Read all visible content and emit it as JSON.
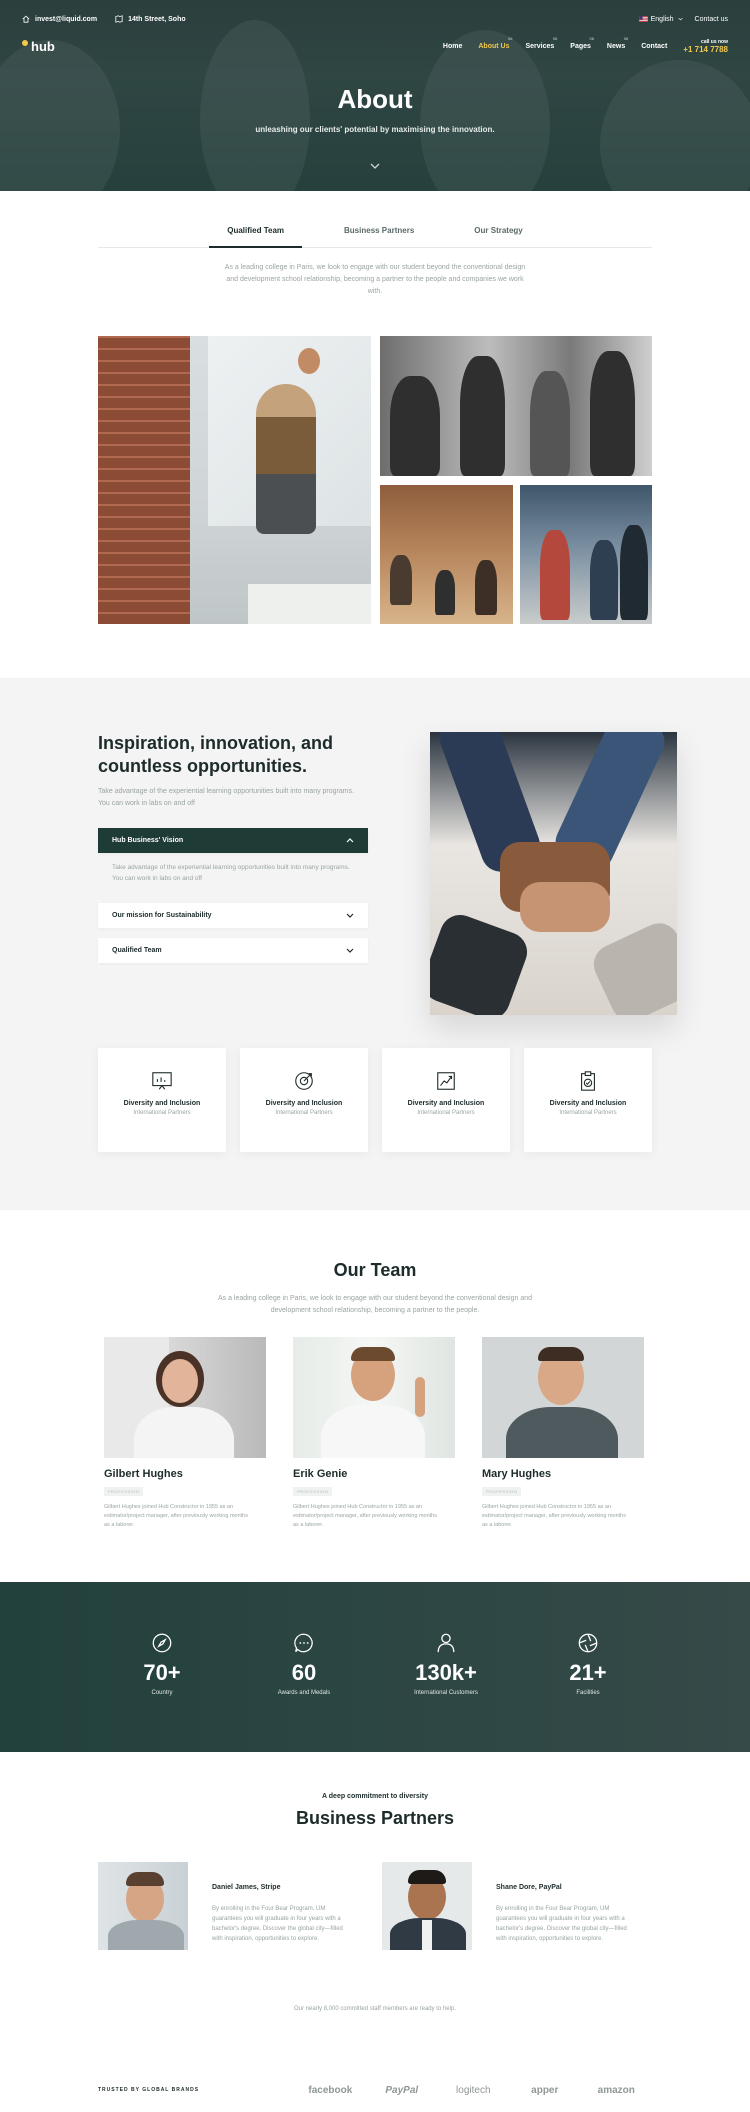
{
  "topbar": {
    "email": "invest@liquid.com",
    "address": "14th Street, Soho",
    "language": "English",
    "contact": "Contact us"
  },
  "logo": {
    "text": "hub"
  },
  "nav": {
    "items": [
      {
        "label": "Home",
        "badge": ""
      },
      {
        "label": "About Us",
        "badge": "06"
      },
      {
        "label": "Services",
        "badge": "06"
      },
      {
        "label": "Pages",
        "badge": "06"
      },
      {
        "label": "News",
        "badge": "06"
      },
      {
        "label": "Contact",
        "badge": ""
      }
    ],
    "call_label": "call us now",
    "phone": "+1 714 7788"
  },
  "hero": {
    "title": "About",
    "subtitle": "unleashing our clients' potential by maximising the innovation."
  },
  "tabs": [
    "Qualified Team",
    "Business Partners",
    "Our Strategy"
  ],
  "intro": "As a leading college in Paris, we look to engage with our student beyond the conventional design and development school relationship, becoming a partner to the people and companies we work with.",
  "inspiration": {
    "title": "Inspiration, innovation, and countless opportunities.",
    "text": "Take advantage of the experiential learning opportunities built into many programs. You can work in labs on and off",
    "accordion": [
      {
        "label": "Hub Business' Vision",
        "open": true
      },
      {
        "label": "Our mission for Sustainability",
        "open": false
      },
      {
        "label": "Qualified Team",
        "open": false
      }
    ],
    "accordion_body": "Take advantage of the experiential learning opportunities built into many programs. You can work in labs on and off",
    "cards": [
      {
        "icon": "presentation-icon",
        "title": "Diversity and Inclusion",
        "sub": "International Partners"
      },
      {
        "icon": "target-icon",
        "title": "Diversity and Inclusion",
        "sub": "International Partners"
      },
      {
        "icon": "growth-chart-icon",
        "title": "Diversity and Inclusion",
        "sub": "International Partners"
      },
      {
        "icon": "clipboard-check-icon",
        "title": "Diversity and Inclusion",
        "sub": "International Partners"
      }
    ]
  },
  "team": {
    "title": "Our Team",
    "subtitle": "As a leading college in Paris, we look to engage with our student beyond the conventional design and development school relationship, becoming a partner to the people.",
    "members": [
      {
        "name": "Gilbert Hughes",
        "role": "PROFESSION",
        "bio": "Gilbert Hughes joined Hub Constructor in 1955 as an estimator/project manager, after previously working months as a laborer."
      },
      {
        "name": "Erik Genie",
        "role": "PROFESSION",
        "bio": "Gilbert Hughes joined Hub Constructor in 1955 as an estimator/project manager, after previously working months as a laborer."
      },
      {
        "name": "Mary Hughes",
        "role": "PROFESSION",
        "bio": "Gilbert Hughes joined Hub Constructor in 1955 as an estimator/project manager, after previously working months as a laborer."
      }
    ]
  },
  "stats": [
    {
      "icon": "compass-icon",
      "number": "70+",
      "label": "Country"
    },
    {
      "icon": "chat-icon",
      "number": "60",
      "label": "Awards and Medals"
    },
    {
      "icon": "user-icon",
      "number": "130k+",
      "label": "International Customers"
    },
    {
      "icon": "aperture-icon",
      "number": "21+",
      "label": "Facilities"
    }
  ],
  "partners": {
    "pretitle": "A deep commitment to diversity",
    "title": "Business Partners",
    "testimonials": [
      {
        "name": "Daniel James, Stripe",
        "quote": "By enrolling in the Four Bear Program, UM guarantees you will graduate in four years with a bachelor's degree. Discover the global city—filled with inspiration, opportunities to explore."
      },
      {
        "name": "Shane Dore, PayPal",
        "quote": "By enrolling in the Four Bear Program, UM guarantees you will graduate in four years with a bachelor's degree. Discover the global city—filled with inspiration, opportunities to explore."
      }
    ],
    "staff_note": "Our nearly 8,000 committed staff members are ready to help."
  },
  "brands": {
    "label": "TRUSTED BY GLOBAL BRANDS",
    "items": [
      "facebook",
      "PayPal",
      "logitech",
      "apper",
      "amazon"
    ]
  },
  "colors": {
    "accent": "#f2c94c",
    "dark": "#1f3b36",
    "text": "#1d2b2b",
    "muted": "#9aa4a4"
  }
}
